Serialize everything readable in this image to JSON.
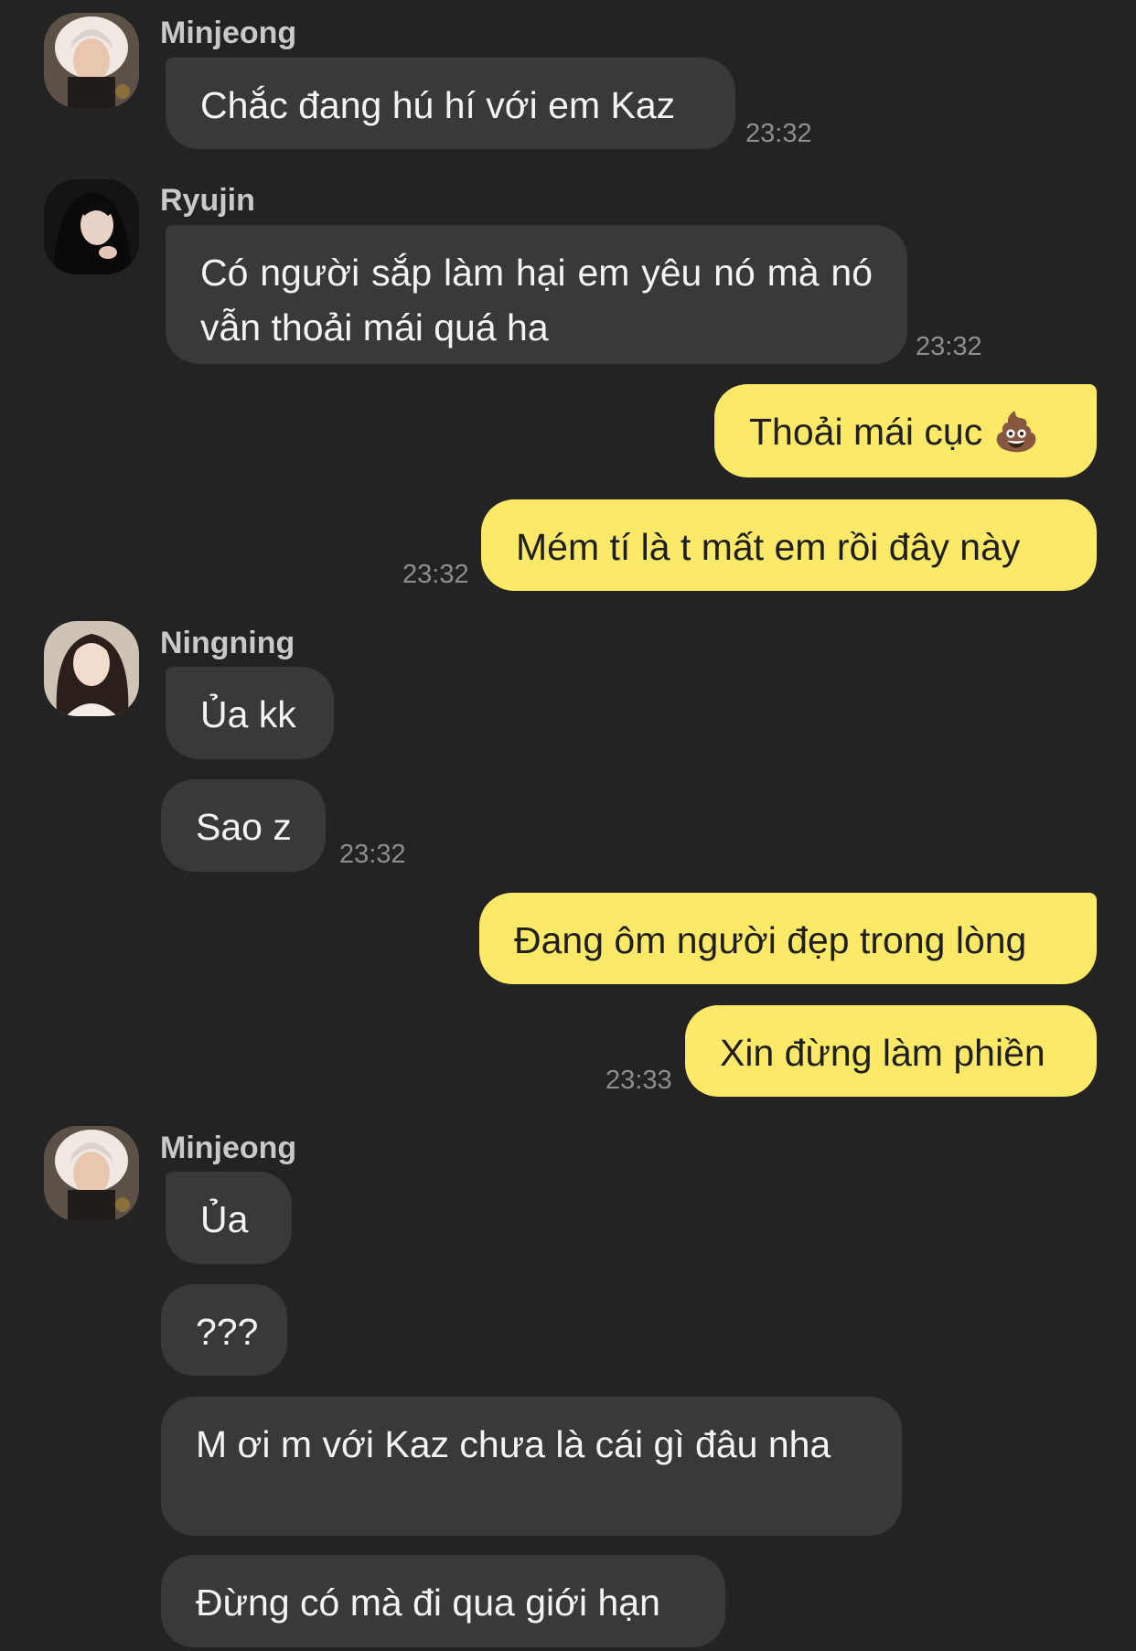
{
  "chat": {
    "messages": [
      {
        "sender": "Minjeong",
        "text": "Chắc đang hú hí với em Kaz",
        "time": "23:32"
      },
      {
        "sender": "Ryujin",
        "text": "Có người sắp làm hại em yêu nó mà nó vẫn thoải mái quá ha",
        "time": "23:32"
      },
      {
        "sender": "me",
        "text": "Thoải mái cục",
        "emoji": "💩"
      },
      {
        "sender": "me",
        "text": "Mém tí là t mất em rồi đây này",
        "time": "23:32"
      },
      {
        "sender": "Ningning",
        "text": "Ủa kk"
      },
      {
        "sender": "Ningning",
        "text": "Sao z",
        "time": "23:32"
      },
      {
        "sender": "me",
        "text": "Đang ôm người đẹp trong lòng"
      },
      {
        "sender": "me",
        "text": "Xin đừng làm phiền",
        "time": "23:33"
      },
      {
        "sender": "Minjeong",
        "text": "Ủa"
      },
      {
        "sender": "Minjeong",
        "text": "???"
      },
      {
        "sender": "Minjeong",
        "text": "M ơi m với Kaz chưa là cái gì đâu nha"
      },
      {
        "sender": "Minjeong",
        "text": "Đừng có mà đi qua giới hạn"
      }
    ]
  },
  "colors": {
    "background": "#232323",
    "incoming_bubble": "#393939",
    "outgoing_bubble": "#fbe967",
    "name_text": "#c9c9c9",
    "time_text": "#8d8d8d"
  },
  "icons": {
    "avatar_minjeong": "avatar-minjeong-icon",
    "avatar_ryujin": "avatar-ryujin-icon",
    "avatar_ningning": "avatar-ningning-icon"
  }
}
